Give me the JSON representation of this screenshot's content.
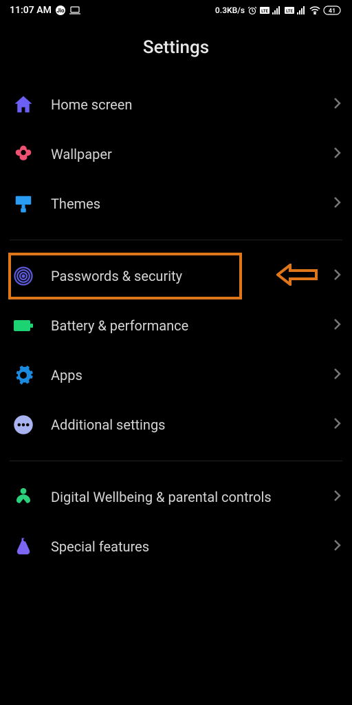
{
  "status": {
    "time": "11:07 AM",
    "speed": "0.3KB/s",
    "battery": "41"
  },
  "title": "Settings",
  "groups": [
    {
      "items": [
        {
          "key": "home-screen",
          "label": "Home screen",
          "icon": "home",
          "color": "#6b5ff6"
        },
        {
          "key": "wallpaper",
          "label": "Wallpaper",
          "icon": "flower",
          "color": "#ee5171"
        },
        {
          "key": "themes",
          "label": "Themes",
          "icon": "brush",
          "color": "#2a9cf4"
        }
      ]
    },
    {
      "items": [
        {
          "key": "passwords-security",
          "label": "Passwords & security",
          "icon": "fingerprint",
          "color": "#5b59d6",
          "highlighted": true
        },
        {
          "key": "battery",
          "label": "Battery & performance",
          "icon": "battery",
          "color": "#1dd272"
        },
        {
          "key": "apps",
          "label": "Apps",
          "icon": "gear",
          "color": "#1a8ae0"
        },
        {
          "key": "additional",
          "label": "Additional settings",
          "icon": "dots",
          "color": "#a8b3f0"
        }
      ]
    },
    {
      "items": [
        {
          "key": "wellbeing",
          "label": "Digital Wellbeing & parental controls",
          "icon": "wellbeing",
          "color": "#2bd07a"
        },
        {
          "key": "special",
          "label": "Special features",
          "icon": "flask",
          "color": "#7a66f3"
        }
      ]
    }
  ]
}
